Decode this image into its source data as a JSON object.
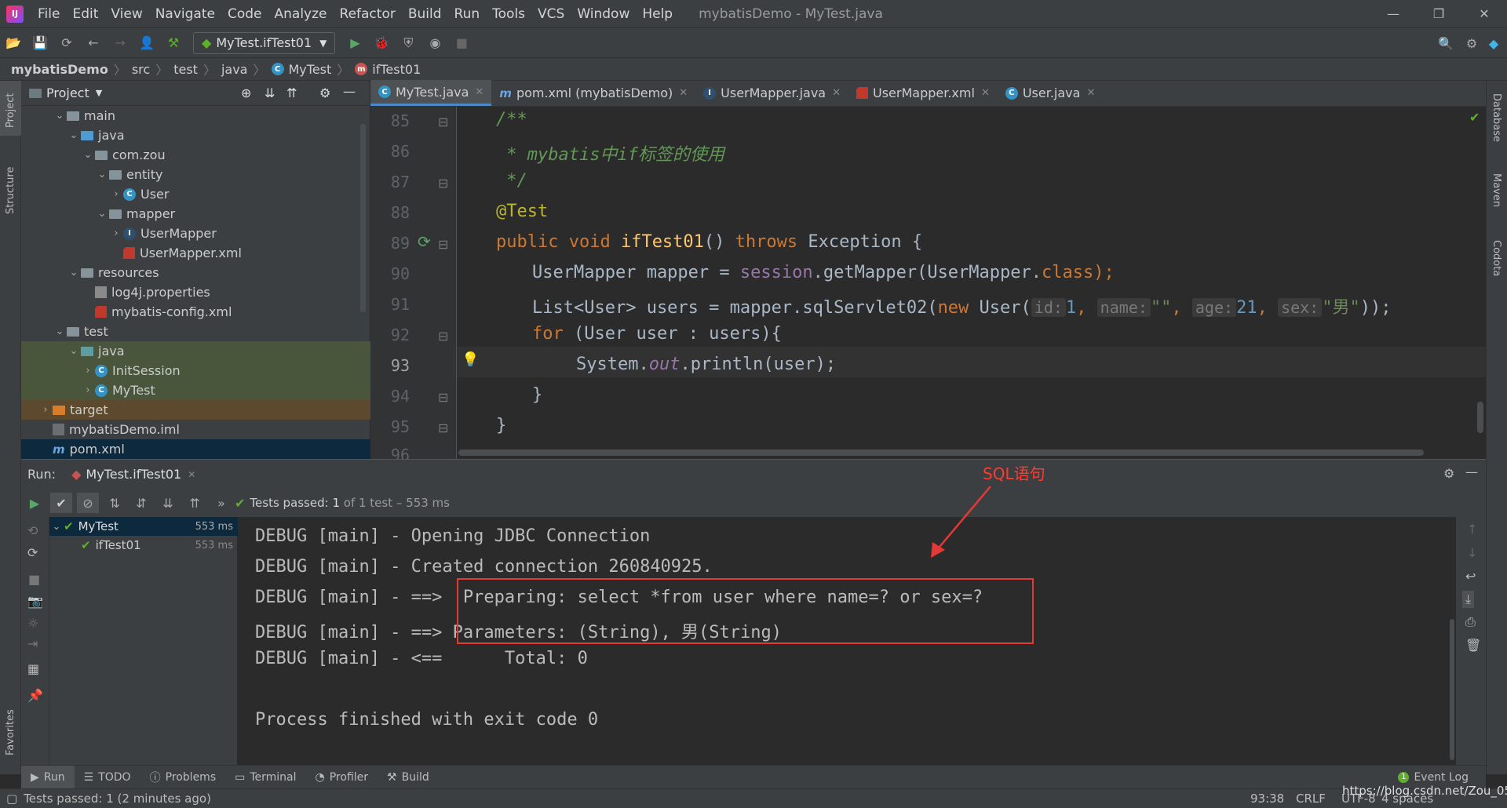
{
  "app": {
    "window_title": "mybatisDemo - MyTest.java",
    "menu": [
      "File",
      "Edit",
      "View",
      "Navigate",
      "Code",
      "Analyze",
      "Refactor",
      "Build",
      "Run",
      "Tools",
      "VCS",
      "Window",
      "Help"
    ],
    "window_buttons": [
      "—",
      "❐",
      "✕"
    ]
  },
  "toolbar": {
    "run_config": "MyTest.ifTest01"
  },
  "breadcrumb": [
    "mybatisDemo",
    "src",
    "test",
    "java",
    "MyTest",
    "ifTest01"
  ],
  "left_strip": {
    "project": "Project",
    "structure": "Structure",
    "favorites": "Favorites"
  },
  "right_strip": {
    "database": "Database",
    "maven": "Maven",
    "codota": "Codota"
  },
  "project_panel": {
    "title": "Project",
    "tree": [
      {
        "label": "main",
        "type": "folder",
        "depth": 2,
        "open": true
      },
      {
        "label": "java",
        "type": "src",
        "depth": 3,
        "open": true
      },
      {
        "label": "com.zou",
        "type": "package",
        "depth": 4,
        "open": true
      },
      {
        "label": "entity",
        "type": "package",
        "depth": 5,
        "open": true
      },
      {
        "label": "User",
        "type": "class",
        "depth": 6,
        "open": false
      },
      {
        "label": "mapper",
        "type": "package",
        "depth": 5,
        "open": true
      },
      {
        "label": "UserMapper",
        "type": "interface",
        "depth": 6,
        "open": false
      },
      {
        "label": "UserMapper.xml",
        "type": "xml",
        "depth": 6
      },
      {
        "label": "resources",
        "type": "res",
        "depth": 3,
        "open": true
      },
      {
        "label": "log4j.properties",
        "type": "props",
        "depth": 4
      },
      {
        "label": "mybatis-config.xml",
        "type": "xml",
        "depth": 4
      },
      {
        "label": "test",
        "type": "folder",
        "depth": 2,
        "open": true
      },
      {
        "label": "java",
        "type": "testsrc",
        "depth": 3,
        "open": true
      },
      {
        "label": "InitSession",
        "type": "class",
        "depth": 4,
        "open": false
      },
      {
        "label": "MyTest",
        "type": "class",
        "depth": 4,
        "open": false
      },
      {
        "label": "target",
        "type": "orange",
        "depth": 1,
        "open": false
      },
      {
        "label": "mybatisDemo.iml",
        "type": "iml",
        "depth": 1
      },
      {
        "label": "pom.xml",
        "type": "maven",
        "depth": 1,
        "selected": true
      }
    ]
  },
  "editor_tabs": [
    {
      "label": "MyTest.java",
      "active": true,
      "icon": "class"
    },
    {
      "label": "pom.xml (mybatisDemo)",
      "icon": "maven"
    },
    {
      "label": "UserMapper.java",
      "icon": "interface"
    },
    {
      "label": "UserMapper.xml",
      "icon": "xml"
    },
    {
      "label": "User.java",
      "icon": "class"
    }
  ],
  "code": {
    "line_numbers": [
      "85",
      "86",
      "87",
      "88",
      "89",
      "90",
      "91",
      "92",
      "93",
      "94",
      "95",
      "96"
    ],
    "current_line": "93",
    "l85": "/**",
    "l86a": " * mybatis",
    "l86b": "中",
    "l86c": "if",
    "l86d": "标签的使用",
    "l87": " */",
    "l88": "@Test",
    "l89_kw1": "public void ",
    "l89_fn": "ifTest01",
    "l89_mid": "() ",
    "l89_kw2": "throws",
    "l89_end": " Exception {",
    "l90a": "UserMapper mapper = ",
    "l90b": "session",
    "l90c": ".getMapper(UserMapper.",
    "l90d": "class",
    "l90e": ");",
    "l91a": "List<User> users = mapper.sqlServlet02(",
    "l91b": "new",
    "l91c": " User(",
    "h_id": "id:",
    "v_id": "1",
    "h_name": "name:",
    "v_name": "\"\"",
    "h_age": "age:",
    "v_age": "21",
    "h_sex": "sex:",
    "v_sex": "\"男\"",
    "l91d": "));",
    "l92a": "for",
    "l92b": " (User user : users){",
    "l93a": "System.",
    "l93b": "out",
    "l93c": ".println(user);",
    "l94": "}",
    "l95": "}"
  },
  "run_panel": {
    "label": "Run:",
    "tab": "MyTest.ifTest01",
    "status_prefix": "Tests passed: ",
    "status_count": "1",
    "status_suffix": " of 1 test – 553 ms",
    "tree": [
      {
        "label": "MyTest",
        "time": "553 ms"
      },
      {
        "label": "ifTest01",
        "time": "553 ms"
      }
    ]
  },
  "console": [
    "DEBUG [main] - Opening JDBC Connection",
    "DEBUG [main] - Created connection 260840925.",
    "DEBUG [main] - ==>  Preparing: select *from user where name=? or sex=?",
    "DEBUG [main] - ==> Parameters: (String), 男(String)",
    "DEBUG [main] - <==      Total: 0",
    "",
    "Process finished with exit code 0"
  ],
  "annotation": {
    "label": "SQL语句",
    "color": "#ff3b30"
  },
  "bottom_tabs": [
    "Run",
    "TODO",
    "Problems",
    "Terminal",
    "Profiler",
    "Build"
  ],
  "event_log": "Event Log",
  "statusbar": {
    "message": "Tests passed: 1 (2 minutes ago)",
    "position": "93:38",
    "line_sep": "CRLF",
    "encoding": "UTF-8",
    "indent": "4 spaces",
    "watermark": "https://blog.csdn.net/Zou_05"
  },
  "colors": {
    "accent": "#4a88c7",
    "passed": "#5faf2d",
    "annotation": "#e53935"
  }
}
